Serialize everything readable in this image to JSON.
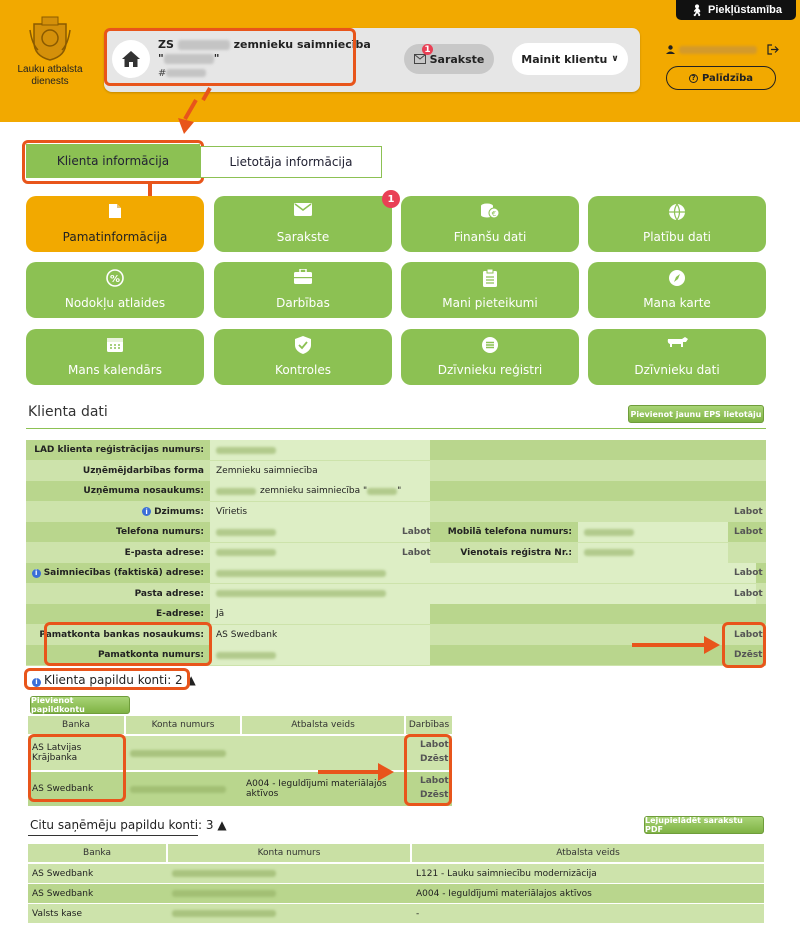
{
  "header": {
    "logo_text": "Lauku atbalsta dienests",
    "accessibility_label": "Piekļūstamība",
    "client_name_prefix": "ZS",
    "client_name_suffix": "zemnieku saimniecība",
    "client_quote_open": "\"",
    "client_quote_close": "\"",
    "client_id_prefix": "#",
    "sarakste_label": "Sarakste",
    "sarakste_badge": "1",
    "mainit_label": "Mainit klientu",
    "palidziba_label": "Palīdzība"
  },
  "tabs": [
    {
      "label": "Klienta informācija"
    },
    {
      "label": "Lietotāja informācija"
    }
  ],
  "tiles": [
    {
      "label": "Pamatinformācija",
      "icon": "document-icon"
    },
    {
      "label": "Sarakste",
      "icon": "envelope-icon",
      "badge": "1"
    },
    {
      "label": "Finanšu dati",
      "icon": "coins-icon"
    },
    {
      "label": "Platību dati",
      "icon": "globe-icon"
    },
    {
      "label": "Nodokļu atlaides",
      "icon": "percent-icon"
    },
    {
      "label": "Darbības",
      "icon": "briefcase-icon"
    },
    {
      "label": "Mani pieteikumi",
      "icon": "clipboard-icon"
    },
    {
      "label": "Mana karte",
      "icon": "compass-icon"
    },
    {
      "label": "Mans kalendārs",
      "icon": "calendar-icon"
    },
    {
      "label": "Kontroles",
      "icon": "shield-icon"
    },
    {
      "label": "Dzīvnieku reģistri",
      "icon": "list-icon"
    },
    {
      "label": "Dzīvnieku dati",
      "icon": "cow-icon"
    }
  ],
  "client_data": {
    "title": "Klienta dati",
    "add_user_button": "Pievienot jaunu EPS lietotāju",
    "rows": [
      {
        "label": "LAD klienta reģistrācijas numurs:",
        "value": ""
      },
      {
        "label": "Uzņēmējdarbības forma",
        "value": "Zemnieku saimniecība"
      },
      {
        "label": "Uzņēmuma nosaukums:",
        "value": "zemnieku saimniecība \"",
        "value_end": "\""
      },
      {
        "label": "Dzimums:",
        "value": "Vīrietis",
        "action": "Labot"
      },
      {
        "label": "Telefona numurs:",
        "value": "",
        "action_mid": "Labot",
        "label2": "Mobilā telefona numurs:",
        "action": "Labot"
      },
      {
        "label": "E-pasta adrese:",
        "value": "",
        "action_mid": "Labot",
        "label2": "Vienotais reģistra Nr.:"
      },
      {
        "label": "Saimniecības (faktiskā) adrese:",
        "value": "",
        "action": "Labot"
      },
      {
        "label": "Pasta adrese:",
        "value": "",
        "action": "Labot"
      },
      {
        "label": "E-adrese:",
        "value": "Jā"
      },
      {
        "label": "Pamatkonta bankas nosaukums:",
        "value": "AS Swedbank",
        "action": "Labot"
      },
      {
        "label": "Pamatkonta numurs:",
        "value": "",
        "action": "Dzēst"
      }
    ]
  },
  "extra_accounts": {
    "title": "Klienta papildu konti: 2 ▲",
    "add_button": "Pievienot papildkontu",
    "headers": [
      "Banka",
      "Konta numurs",
      "Atbalsta veids",
      "Darbības"
    ],
    "rows": [
      {
        "bank": "AS Latvijas Krājbanka",
        "support": "",
        "edit": "Labot",
        "delete": "Dzēst"
      },
      {
        "bank": "AS Swedbank",
        "support": "A004 - Ieguldījumi materiālajos aktīvos",
        "edit": "Labot",
        "delete": "Dzēst"
      }
    ]
  },
  "other_accounts": {
    "title": "Citu saņēmēju papildu konti: 3 ▲",
    "download_button": "Lejupielādēt sarakstu PDF",
    "headers": [
      "Banka",
      "Konta numurs",
      "Atbalsta veids"
    ],
    "rows": [
      {
        "bank": "AS Swedbank",
        "support": "L121 - Lauku saimniecību modernizācija"
      },
      {
        "bank": "AS Swedbank",
        "support": "A004 - Ieguldījumi materiālajos aktīvos"
      },
      {
        "bank": "Valsts kase",
        "support": "-"
      }
    ]
  },
  "colors": {
    "brand_orange": "#f2a900",
    "brand_green": "#8cc153",
    "highlight": "#e8551b",
    "badge_red": "#e94055"
  }
}
